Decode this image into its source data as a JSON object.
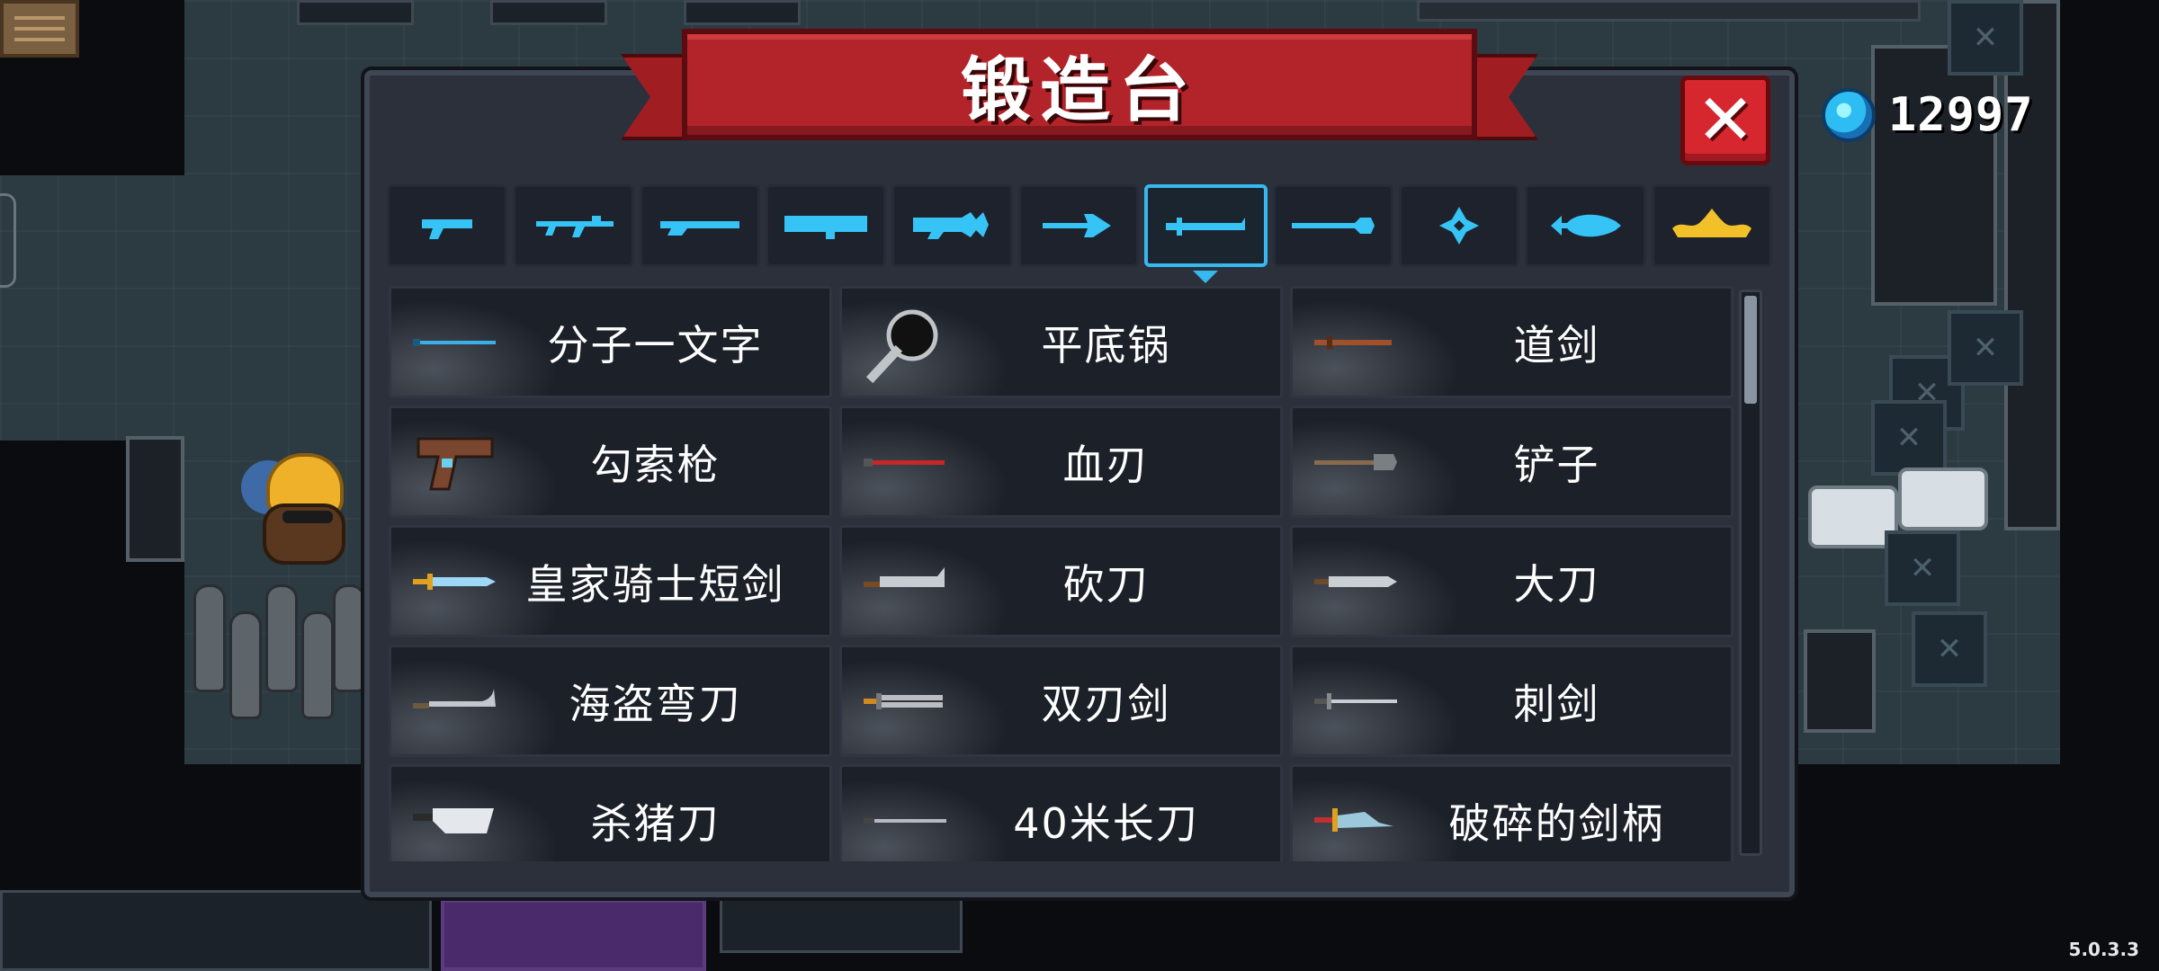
{
  "panel": {
    "title": "锻造台",
    "close_label": "✕"
  },
  "currency": {
    "icon": "blue-gem-icon",
    "value": "12997"
  },
  "version": "5.0.3.3",
  "tabs": [
    {
      "icon": "pistol-icon",
      "active": false
    },
    {
      "icon": "rifle-icon",
      "active": false
    },
    {
      "icon": "shotgun-icon",
      "active": false
    },
    {
      "icon": "launcher-icon",
      "active": false
    },
    {
      "icon": "laser-gun-icon",
      "active": false
    },
    {
      "icon": "bow-icon",
      "active": false
    },
    {
      "icon": "sword-icon",
      "active": true
    },
    {
      "icon": "spear-icon",
      "active": false
    },
    {
      "icon": "shuriken-icon",
      "active": false
    },
    {
      "icon": "fish-icon",
      "active": false
    },
    {
      "icon": "crown-icon",
      "active": false
    }
  ],
  "items": [
    {
      "name": "分子一文字",
      "icon": "thin-blue-blade-icon"
    },
    {
      "name": "平底锅",
      "icon": "frying-pan-icon"
    },
    {
      "name": "道剑",
      "icon": "wooden-sword-icon"
    },
    {
      "name": "勾索枪",
      "icon": "grapple-gun-icon"
    },
    {
      "name": "血刃",
      "icon": "blood-blade-icon"
    },
    {
      "name": "铲子",
      "icon": "shovel-icon"
    },
    {
      "name": "皇家骑士短剑",
      "icon": "royal-dagger-icon"
    },
    {
      "name": "砍刀",
      "icon": "machete-icon"
    },
    {
      "name": "大刀",
      "icon": "broadsword-icon"
    },
    {
      "name": "海盗弯刀",
      "icon": "cutlass-icon"
    },
    {
      "name": "双刃剑",
      "icon": "double-blade-icon"
    },
    {
      "name": "刺剑",
      "icon": "rapier-icon"
    },
    {
      "name": "杀猪刀",
      "icon": "cleaver-icon"
    },
    {
      "name": "40米长刀",
      "icon": "long-blade-icon"
    },
    {
      "name": "破碎的剑柄",
      "icon": "broken-hilt-icon"
    }
  ]
}
